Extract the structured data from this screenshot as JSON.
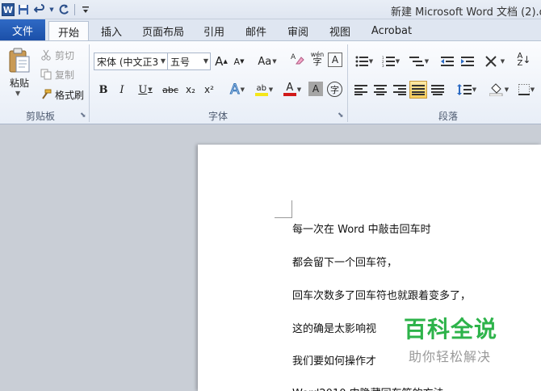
{
  "window": {
    "title": "新建 Microsoft Word 文档 (2).dc"
  },
  "qat": {
    "app_icon_letter": "W",
    "items": [
      "save-icon",
      "undo-icon",
      "redo-icon",
      "customize-icon"
    ]
  },
  "tabs": [
    {
      "label": "文件"
    },
    {
      "label": "开始"
    },
    {
      "label": "插入"
    },
    {
      "label": "页面布局"
    },
    {
      "label": "引用"
    },
    {
      "label": "邮件"
    },
    {
      "label": "审阅"
    },
    {
      "label": "视图"
    },
    {
      "label": "Acrobat"
    }
  ],
  "clipboard": {
    "paste_label": "粘贴",
    "cut_label": "剪切",
    "copy_label": "复制",
    "format_painter_label": "格式刷",
    "group_label": "剪贴板"
  },
  "font": {
    "font_name": "宋体 (中文正3",
    "font_size": "五号",
    "group_label": "字体",
    "bold": "B",
    "italic": "I",
    "underline": "U",
    "strike": "abc",
    "subscript": "x₂",
    "superscript": "x²",
    "change_case": "Aa",
    "grow": "A",
    "shrink": "A",
    "text_effect": "A",
    "font_color": "A",
    "char_shading": "A",
    "enclosed": "字",
    "phonetic": "wén",
    "highlight": "ab"
  },
  "paragraph": {
    "group_label": "段落"
  },
  "document": {
    "lines": [
      "每一次在 Word 中敲击回车时",
      "都会留下一个回车符，",
      "回车次数多了回车符也就跟着变多了，",
      "这的确是太影响视",
      "我们要如何操作才",
      "Word2010 中隐藏回车符的方法"
    ]
  },
  "watermark": {
    "main": "百科全说",
    "sub": "助你轻松解决"
  },
  "colors": {
    "file_tab": "#1b4fa8",
    "ribbon_bg": "#f3f6fb",
    "watermark_green": "#2db34a",
    "font_color_bar": "#d11a1a",
    "highlight_bar": "#f4e61a"
  }
}
